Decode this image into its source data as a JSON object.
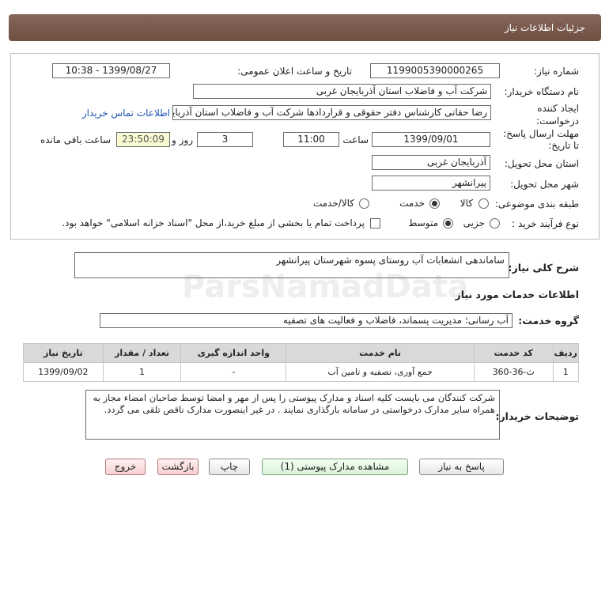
{
  "page_title": "جزئیات اطلاعات نیاز",
  "fields": {
    "need_number_label": "شماره نیاز:",
    "need_number": "1199005390000265",
    "announce_label": "تاریخ و ساعت اعلان عمومی:",
    "announce_value": "1399/08/27 - 10:38",
    "buyer_org_label": "نام دستگاه خریدار:",
    "buyer_org": "شرکت آب و فاضلاب استان آذربایجان غربی",
    "creator_label_1": "ایجاد کننده",
    "creator_label_2": "درخواست:",
    "creator": "رضا حقانی کارشناس دفتر حقوقی و قراردادها شرکت آب و فاضلاب استان آذربایجان غربی",
    "contact_link": "اطلاعات تماس خریدار",
    "deadline_label_1": "مهلت ارسال پاسخ:",
    "deadline_label_2": "تا تاریخ:",
    "deadline_date": "1399/09/01",
    "time_label": "ساعت",
    "deadline_time": "11:00",
    "days_value": "3",
    "days_label": "روز و",
    "remaining_time": "23:50:09",
    "remaining_label": "ساعت باقی مانده",
    "province_label": "استان محل تحویل:",
    "province": "آذربایجان غربی",
    "city_label": "شهر محل تحویل:",
    "city": "پیرانشهر",
    "category_label": "طبقه بندی موضوعی:",
    "category_options": [
      "کالا",
      "خدمت",
      "کالا/خدمت"
    ],
    "process_label": "نوع فرآیند خرید :",
    "process_options": [
      "جزیی",
      "متوسط"
    ],
    "payment_note": "پرداخت تمام یا بخشی از مبلغ خرید،از محل \"اسناد خزانه اسلامی\" خواهد بود."
  },
  "summary": {
    "label": "شرح کلی نیاز:",
    "value": "ساماندهی انشعابات آب روستای پسوه شهرستان پیرانشهر"
  },
  "services_header": "اطلاعات خدمات مورد نیاز",
  "service_group": {
    "label": "گروه خدمت:",
    "value": "آب رسانی؛ مدیریت پسماند، فاضلاب و فعالیت های تصفیه"
  },
  "table": {
    "headers": [
      "ردیف",
      "کد خدمت",
      "نام خدمت",
      "واحد اندازه گیری",
      "تعداد / مقدار",
      "تاریخ نیاز"
    ],
    "rows": [
      [
        "1",
        "ث-36-360",
        "جمع آوری، تصفیه و تامین آب",
        "-",
        "1",
        "1399/09/02"
      ]
    ]
  },
  "buyer_notes": {
    "label": "توضیحات خریدار:",
    "value": "شرکت کنندگان می بایست کلیه اسناد و مدارک پیوستی را پس از مهر و امضا توسط صاحبان امضاء مجاز به همراه سایر مدارک درخواستی در سامانه بارگذاری نمایند . در غیر اینصورت مدارک ناقص تلقی می گردد."
  },
  "buttons": {
    "reply": "پاسخ به نیاز",
    "attachments": "مشاهده مدارک پیوستی (1)",
    "print": "چاپ",
    "back": "بازگشت",
    "exit": "خروج"
  },
  "watermark": "ParsNamadData"
}
